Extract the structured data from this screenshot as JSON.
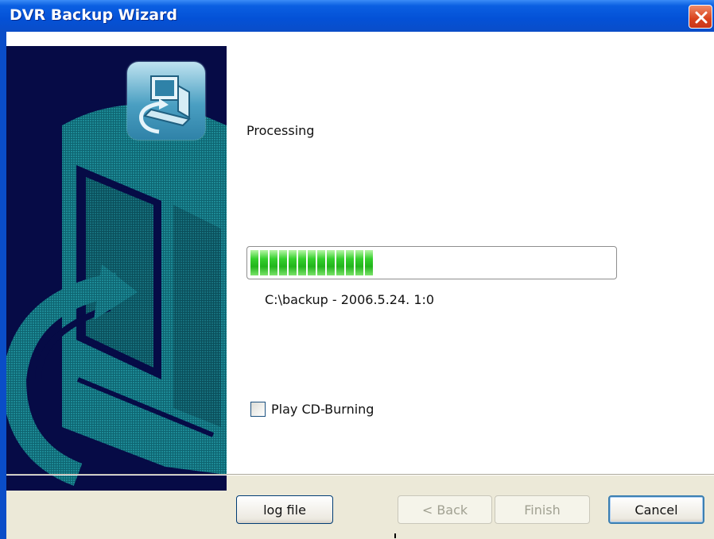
{
  "window": {
    "title": "DVR Backup Wizard",
    "close_icon": "close-icon"
  },
  "side_panel": {
    "icon": "computer-backup-icon",
    "colors": {
      "background": "#060b46",
      "accent": "#1d8a96"
    }
  },
  "main": {
    "status_text": "Processing",
    "progress": {
      "value": 0.34
    },
    "current_file": "C:\\backup - 2006.5.24. 1:0",
    "checkbox": {
      "label": "Play CD-Burning",
      "checked": false
    }
  },
  "buttons": {
    "log_file": "log file",
    "back": "< Back",
    "finish": "Finish",
    "cancel": "Cancel"
  },
  "colors": {
    "titlebar": "#0451d6",
    "close_button": "#d9421c",
    "progress_fill": "#22b51c",
    "dialog_bg": "#ece9d8"
  }
}
